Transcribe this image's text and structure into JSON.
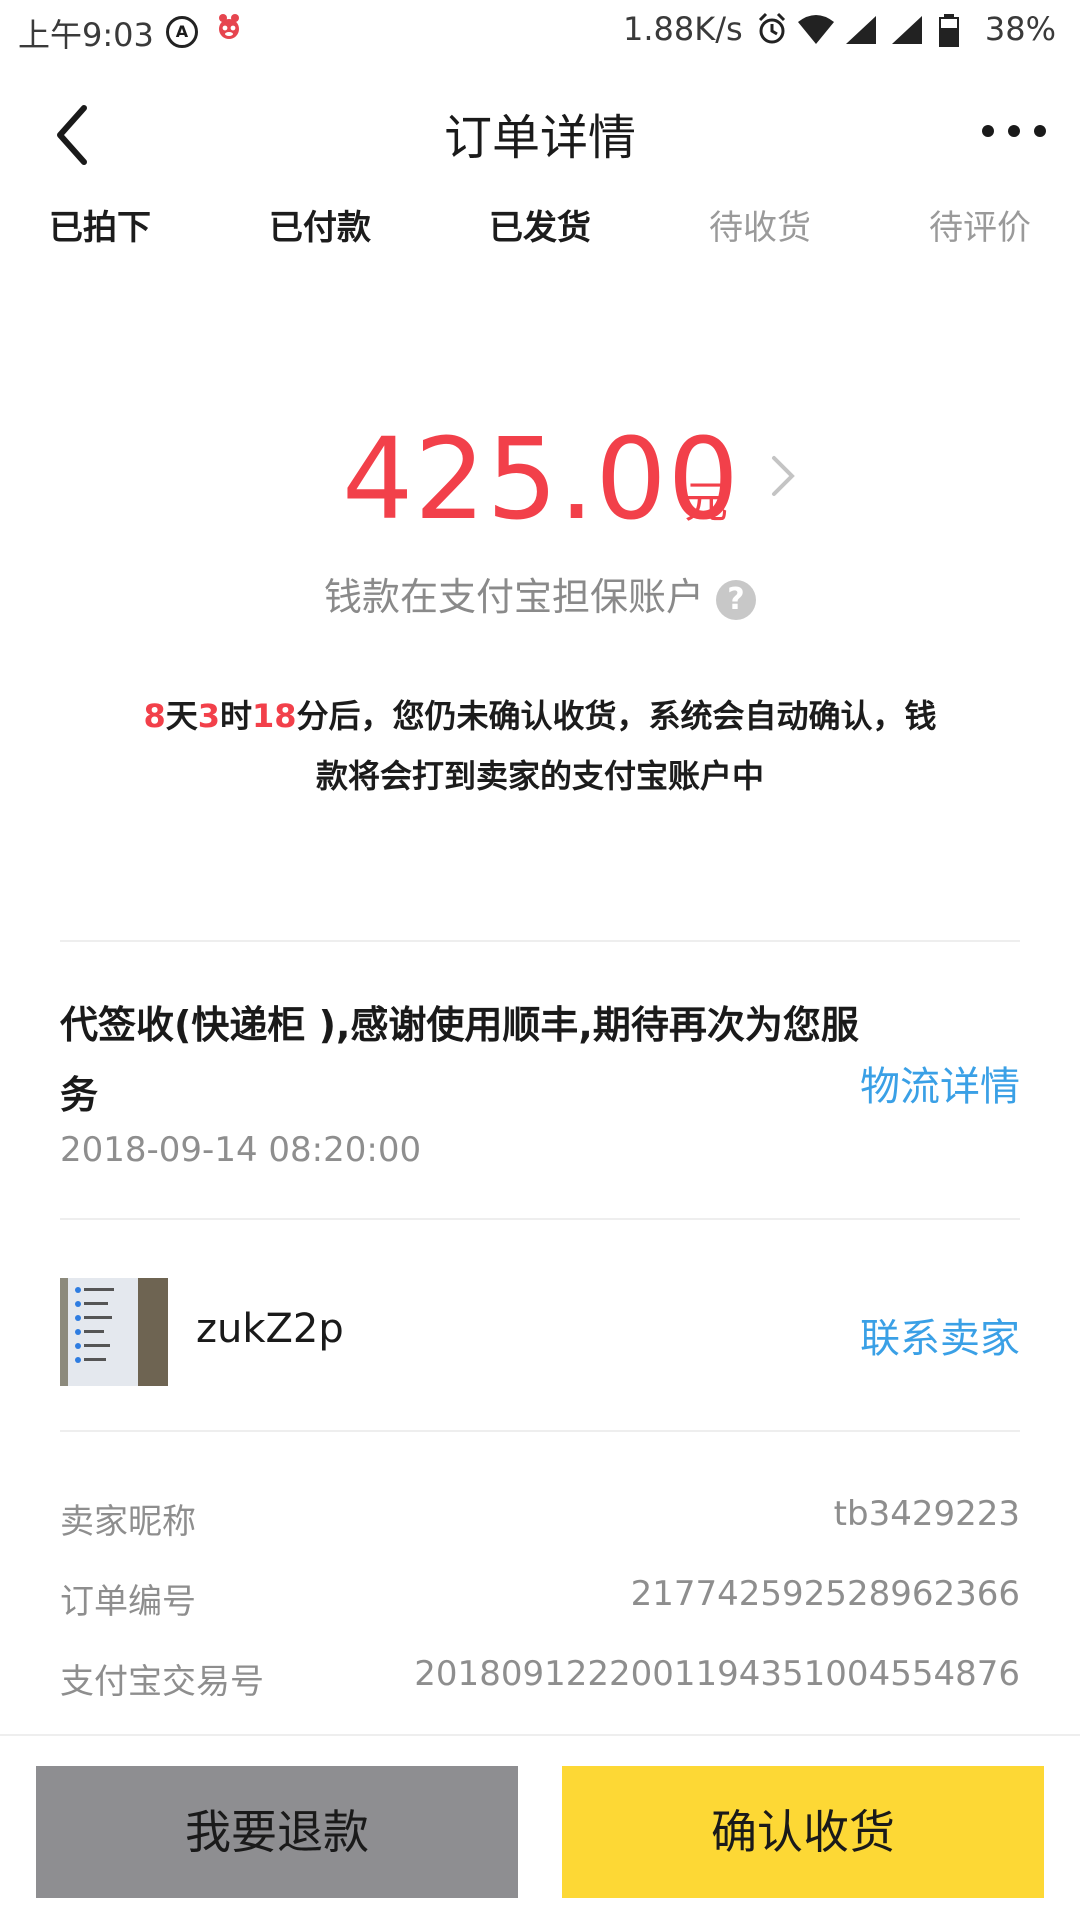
{
  "status_bar": {
    "time": "上午9:03",
    "a_badge": "A",
    "net_speed": "1.88K/s",
    "battery": "38%"
  },
  "header": {
    "title": "订单详情"
  },
  "steps": [
    {
      "label": "已拍下",
      "state": "done"
    },
    {
      "label": "已付款",
      "state": "done"
    },
    {
      "label": "已发货",
      "state": "done"
    },
    {
      "label": "待收货",
      "state": "todo"
    },
    {
      "label": "待评价",
      "state": "todo"
    }
  ],
  "amount": {
    "value": "425.00",
    "unit": "元",
    "escrow_text": "钱款在支付宝担保账户",
    "help_symbol": "?"
  },
  "notice": {
    "days": "8",
    "days_unit": "天",
    "hours": "3",
    "hours_unit": "时",
    "minutes": "18",
    "rest": "分后，您仍未确认收货，系统会自动确认，钱款将会打到卖家的支付宝账户中"
  },
  "logistics": {
    "message": "代签收(快递柜 ),感谢使用顺丰,期待再次为您服务",
    "link": "物流详情",
    "time": "2018-09-14 08:20:00"
  },
  "seller": {
    "name": "zukZ2p",
    "contact": "联系卖家"
  },
  "info": [
    {
      "label": "卖家昵称",
      "value": "tb3429223"
    },
    {
      "label": "订单编号",
      "value": "217742592528962366"
    },
    {
      "label": "支付宝交易号",
      "value": "2018091222001194351004554876"
    }
  ],
  "actions": {
    "refund": "我要退款",
    "confirm": "确认收货"
  },
  "colors": {
    "accent_red": "#f2404a",
    "link_blue": "#3aa0e6",
    "confirm_yellow": "#fdd835",
    "refund_gray": "#8e8e91"
  }
}
